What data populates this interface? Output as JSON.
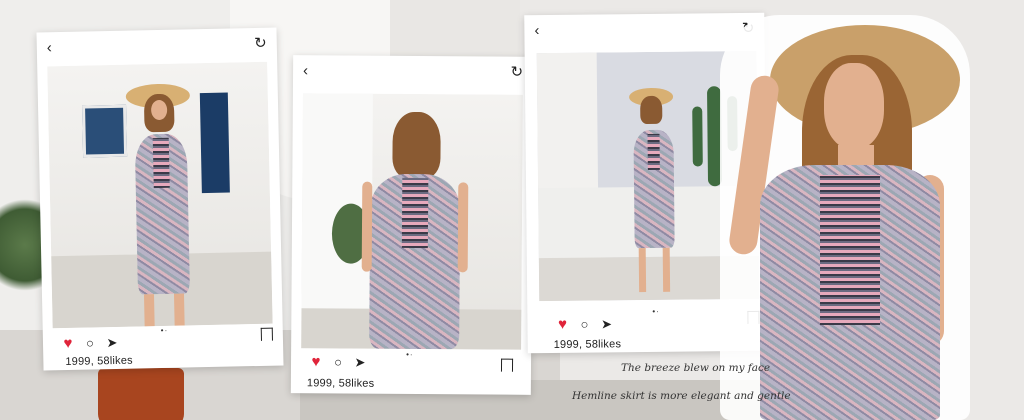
{
  "cards": [
    {
      "likes": "1999, 58likes",
      "back_icon": "chevron-left-icon",
      "reload_icon": "reload-icon"
    },
    {
      "likes": "1999, 58likes",
      "back_icon": "chevron-left-icon",
      "reload_icon": "reload-icon"
    },
    {
      "likes": "1999, 58likes",
      "back_icon": "chevron-left-icon",
      "reload_icon": "reload-icon"
    }
  ],
  "captions": {
    "line1": "The breeze blew on my face",
    "line2": "Hemline skirt is more elegant and gentle"
  },
  "colors": {
    "heart": "#e0243a",
    "card": "#ffffff",
    "pot": "#a8451f"
  }
}
